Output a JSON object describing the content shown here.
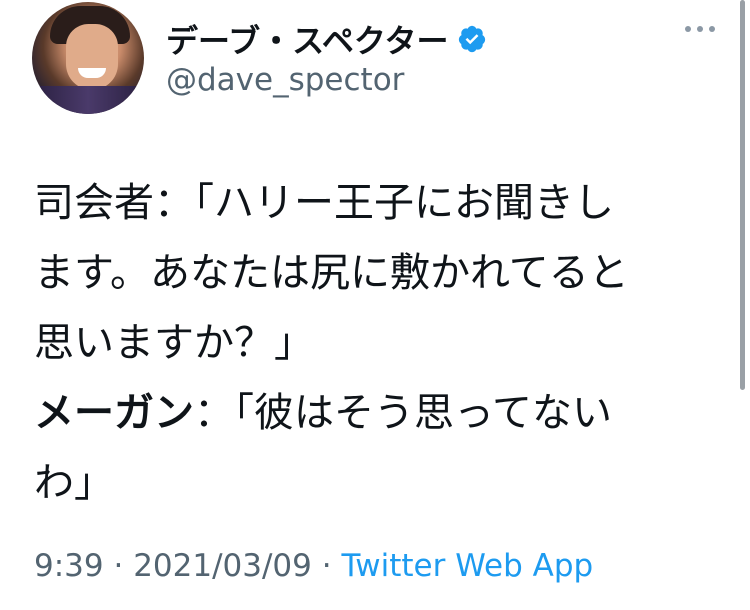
{
  "author": {
    "display_name": "デーブ・スペクター",
    "handle": "@dave_spector",
    "verified": true
  },
  "tweet": {
    "lines": [
      "司会者：「ハリー王子にお聞きし",
      "ます。あなたは尻に敷かれてると",
      "思いますか？」"
    ],
    "reply_speaker": "メーガン",
    "reply_colon": "：",
    "reply_text_line1": "「彼はそう思ってない",
    "reply_text_line2": "わ」"
  },
  "meta": {
    "time": "9:39",
    "separator1": " · ",
    "date": "2021/03/09",
    "separator2": " · ",
    "source": "Twitter Web App"
  },
  "colors": {
    "accent": "#1d9bf0",
    "secondary_text": "#536471",
    "primary_text": "#0f1419"
  },
  "icons": {
    "verified": "verified-badge-icon",
    "more": "more-options-icon"
  }
}
